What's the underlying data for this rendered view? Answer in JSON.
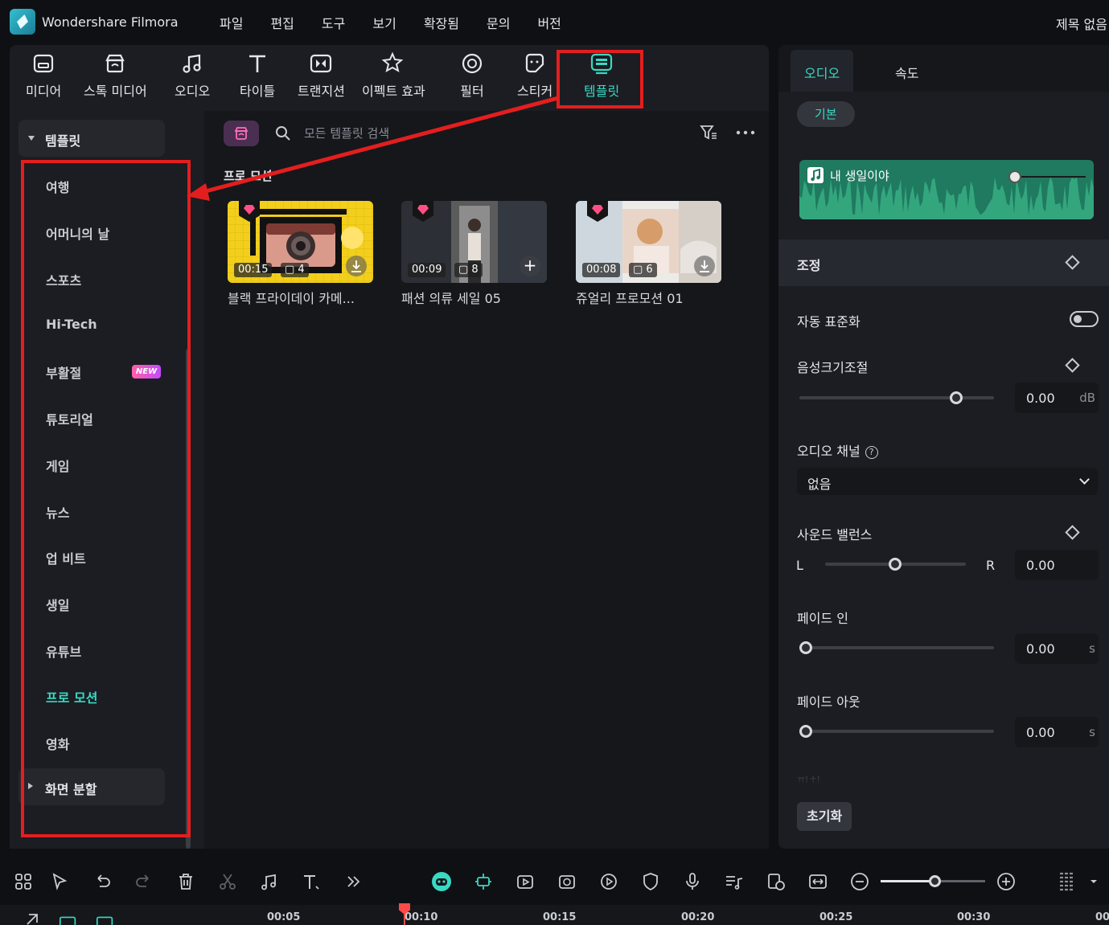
{
  "app": {
    "name": "Wondershare Filmora",
    "project_title": "제목 없음"
  },
  "menu": [
    "파일",
    "편집",
    "도구",
    "보기",
    "확장됨",
    "문의",
    "버전"
  ],
  "toolbar": {
    "tools": [
      {
        "label": "미디어",
        "icon": "media-icon"
      },
      {
        "label": "스톡 미디어",
        "icon": "stock-media-icon"
      },
      {
        "label": "오디오",
        "icon": "audio-icon"
      },
      {
        "label": "타이틀",
        "icon": "title-icon"
      },
      {
        "label": "트랜지션",
        "icon": "transition-icon"
      },
      {
        "label": "이펙트 효과",
        "icon": "effects-icon"
      },
      {
        "label": "필터",
        "icon": "filter-icon"
      },
      {
        "label": "스티커",
        "icon": "sticker-icon"
      },
      {
        "label": "템플릿",
        "icon": "template-icon",
        "active": true
      }
    ]
  },
  "sidebar": {
    "header": "템플릿",
    "items": [
      {
        "label": "여행"
      },
      {
        "label": "어머니의 날"
      },
      {
        "label": "스포츠"
      },
      {
        "label": "Hi-Tech"
      },
      {
        "label": "부활절",
        "badge": "NEW"
      },
      {
        "label": "튜토리얼"
      },
      {
        "label": "게임"
      },
      {
        "label": "뉴스"
      },
      {
        "label": "업 비트"
      },
      {
        "label": "생일"
      },
      {
        "label": "유튜브"
      },
      {
        "label": "프로 모션",
        "active": true
      },
      {
        "label": "영화"
      }
    ],
    "footer": "화면 분할"
  },
  "content": {
    "search_placeholder": "모든 템플릿 검색",
    "section_title": "프로 모션",
    "cards": [
      {
        "title": "블랙 프라이데이 카메...",
        "duration": "00:15",
        "clips": "4",
        "action": "download"
      },
      {
        "title": "패션 의류 세일 05",
        "duration": "00:09",
        "clips": "8",
        "action": "add"
      },
      {
        "title": "쥬얼리 프로모션 01",
        "duration": "00:08",
        "clips": "6",
        "action": "download"
      }
    ]
  },
  "right_panel": {
    "tabs": [
      "오디오",
      "속도"
    ],
    "active_tab": "오디오",
    "basic_pill": "기본",
    "audio_clip_name": "내 생일이야",
    "adjust_header": "조정",
    "auto_normalize": {
      "label": "자동 표준화",
      "on": false
    },
    "volume": {
      "label": "음성크기조절",
      "value": "0.00",
      "unit": "dB"
    },
    "audio_channel": {
      "label": "오디오 채널",
      "value": "없음"
    },
    "balance": {
      "label": "사운드 밸런스",
      "left": "L",
      "right": "R",
      "value": "0.00"
    },
    "fade_in": {
      "label": "페이드 인",
      "value": "0.00",
      "unit": "s"
    },
    "fade_out": {
      "label": "페이드 아웃",
      "value": "0.00",
      "unit": "s"
    },
    "pitch_label": "피치",
    "reset": "초기화"
  },
  "timeline": {
    "ticks": [
      "00:05",
      "00:10",
      "00:15",
      "00:20",
      "00:25",
      "00:30",
      "00"
    ]
  },
  "colors": {
    "accent": "#39d9c4",
    "annotation_red": "#e41e1e",
    "waveform": "#1f7a5f"
  }
}
